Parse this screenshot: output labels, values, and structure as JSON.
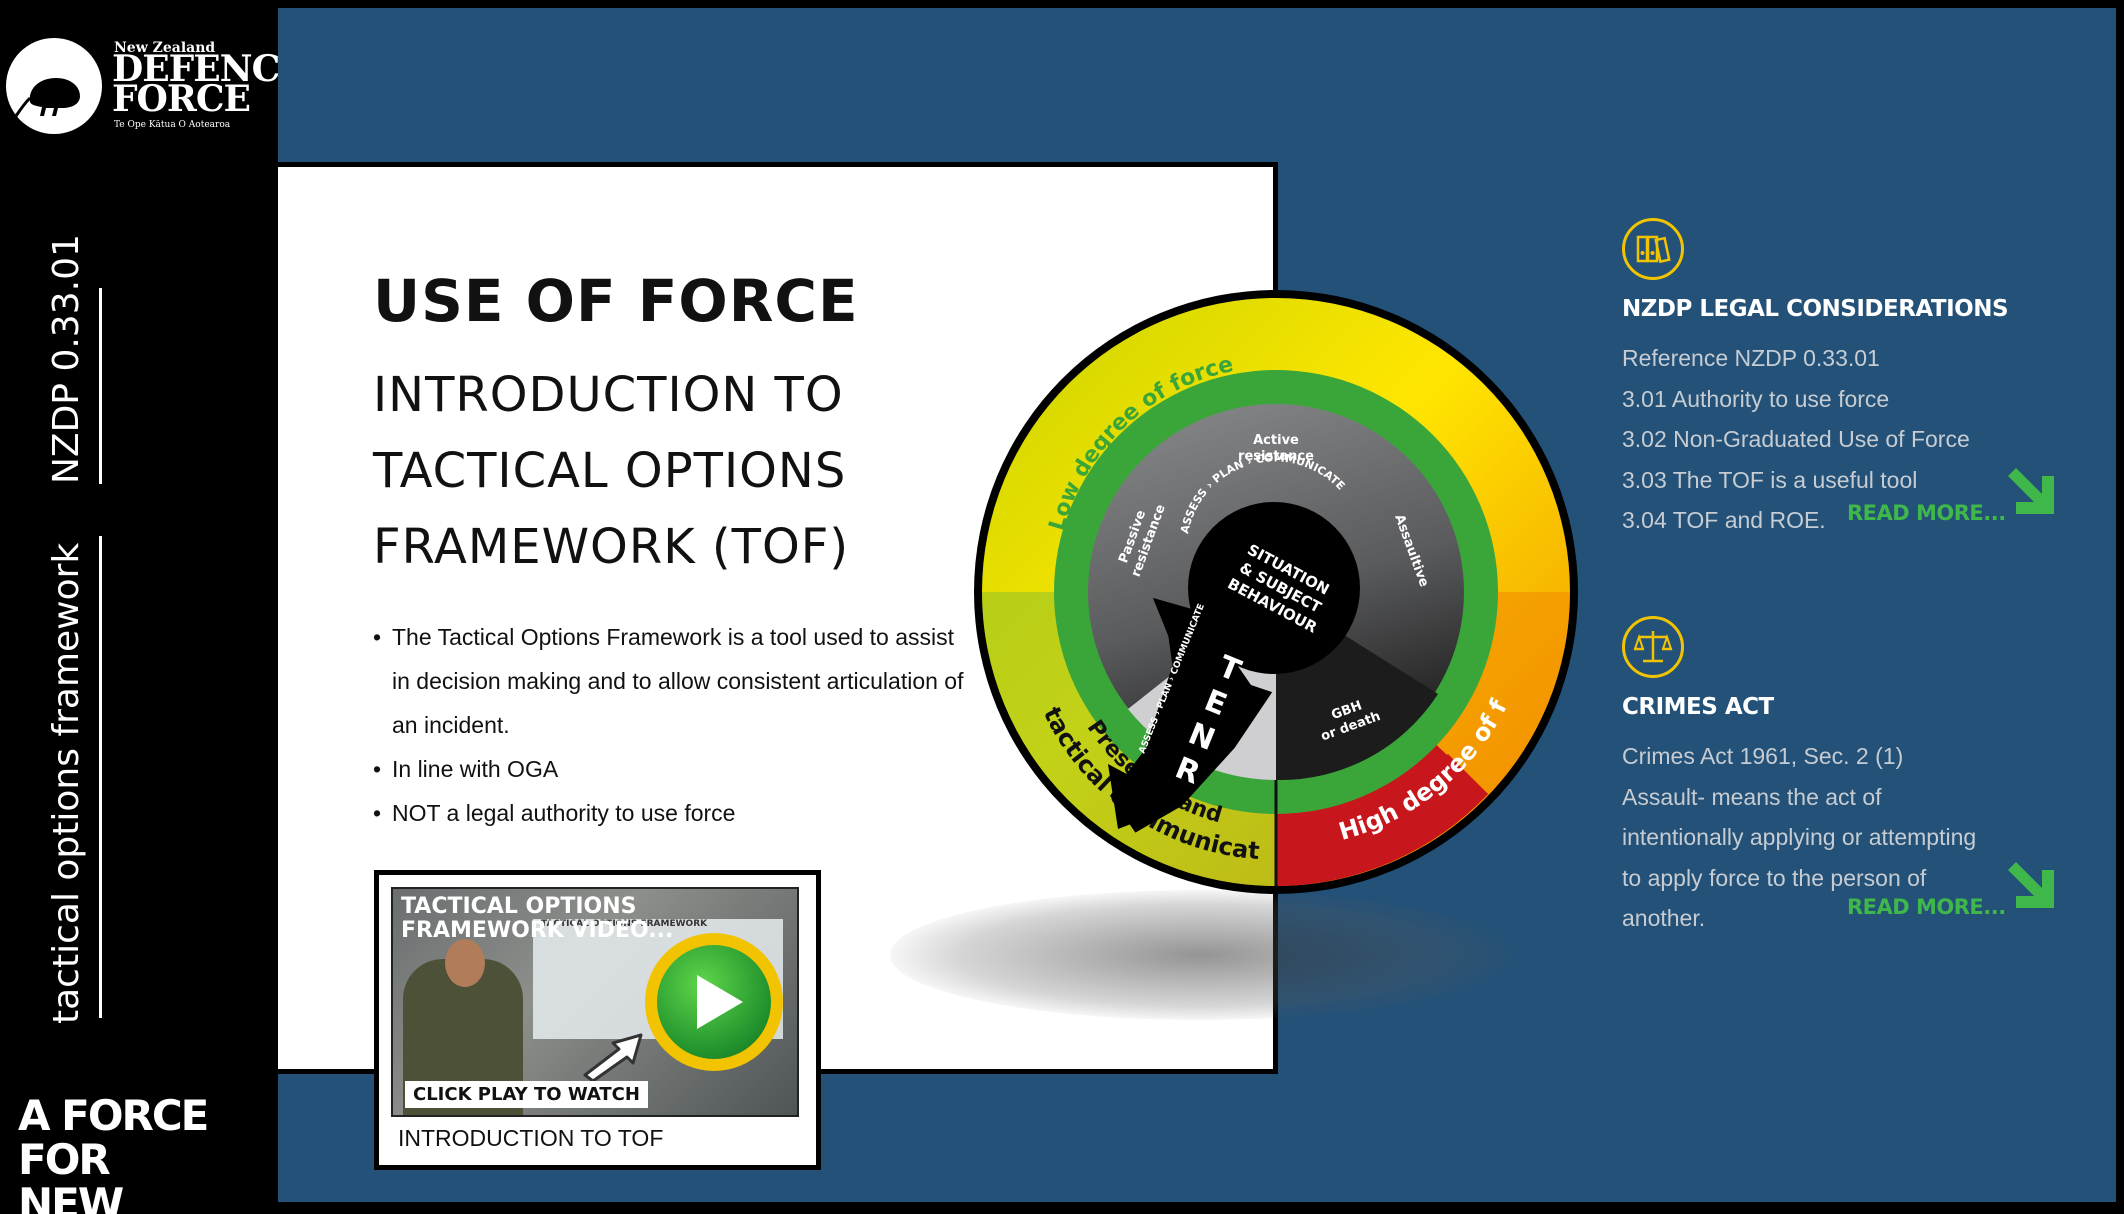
{
  "sidebar": {
    "logo": {
      "country": "New Zealand",
      "line1": "DEFENCE",
      "line2": "FORCE",
      "subline": "Te Ope Kātua O Aotearoa"
    },
    "document_code": "NZDP 0.33.01",
    "vertical_title": "tactical options framework",
    "tagline_line1": "A FORCE FOR",
    "tagline_line2": "NEW ZEALAND"
  },
  "card": {
    "title": "USE OF FORCE",
    "subtitle": "INTRODUCTION TO TACTICAL OPTIONS FRAMEWORK (TOF)",
    "bullets": [
      "The Tactical Options Framework is a tool used to assist in decision making and to allow consistent articulation of an incident.",
      "In line with OGA",
      "NOT a legal authority to use force"
    ]
  },
  "video": {
    "thumb_title": "TACTICAL OPTIONS FRAMEWORK VIDEO...",
    "screen_title": "TACTICAL OPTIONS FRAMEWORK",
    "cta": "CLICK PLAY TO WATCH",
    "caption": "INTRODUCTION TO TOF"
  },
  "diagram": {
    "outer_top_label": "Low degree of force",
    "outer_bottom_right_label": "High degree of force",
    "outer_bottom_left_label_1": "Presence and",
    "outer_bottom_left_label_2": "tactical communication",
    "zone_active": "Active",
    "zone_active_2": "resistance",
    "zone_passive": "Passive",
    "zone_passive_2": "resistance",
    "zone_assaultive": "Assaultive",
    "zone_gbh": "GBH",
    "zone_gbh_2": "or death",
    "center_1": "SITUATION",
    "center_2": "& SUBJECT",
    "center_3": "BEHAVIOUR",
    "ring_text": "ASSESS › PLAN › COMMUNICATE",
    "arrow_letters": [
      "T",
      "E",
      "N",
      "R"
    ],
    "arrow_text": "ASSESS › PLAN › COMMUNICATE",
    "colors": {
      "yellow": "#ffe600",
      "orange": "#f29a00",
      "red": "#c8161d",
      "lime": "#b7cf1a",
      "green": "#3aa639",
      "grey": "#6d6e70"
    }
  },
  "legal": {
    "icon": "binders-icon",
    "title": "NZDP LEGAL CONSIDERATIONS",
    "lines": [
      "Reference NZDP 0.33.01",
      "3.01 Authority to use force",
      "3.02 Non-Graduated Use of Force",
      "3.03 The TOF is a useful tool",
      "3.04 TOF and ROE."
    ],
    "read_more": "READ MORE..."
  },
  "crimes": {
    "icon": "scales-icon",
    "title": "CRIMES ACT",
    "lines": [
      "Crimes Act 1961, Sec. 2 (1)",
      "Assault- means the act of",
      "intentionally applying or attempting",
      "to apply force to the person of",
      "another."
    ],
    "read_more": "READ MORE..."
  }
}
